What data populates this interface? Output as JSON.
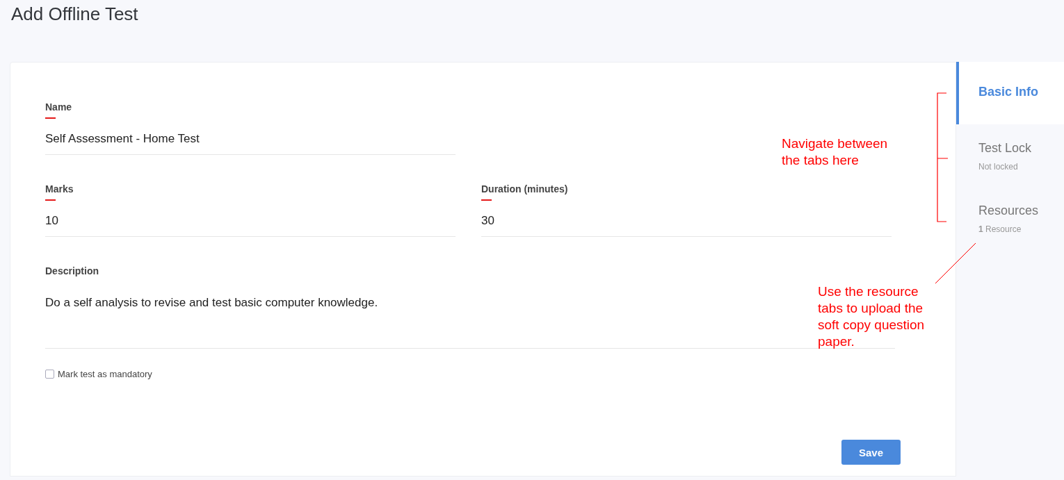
{
  "page_title": "Add Offline Test",
  "form_rows": [
    [
      {
        "label": "Name",
        "value": "Self Assessment - Home Test",
        "required": true
      }
    ],
    [
      {
        "label": "Marks",
        "value": "10",
        "required": true
      },
      {
        "label": "Duration (minutes)",
        "value": "30",
        "required": true
      }
    ],
    [
      {
        "label": "Description",
        "value": "Do a self analysis to revise and test basic computer knowledge.",
        "required": false
      }
    ]
  ],
  "checkbox": {
    "label": "Mark test as mandatory",
    "checked": false
  },
  "save_button": "Save",
  "tabs": [
    {
      "label": "Basic Info",
      "selected": true
    },
    {
      "label": "Test Lock",
      "sublabel": "Not locked",
      "selected": false
    },
    {
      "label": "Resources",
      "sublabel": "**1** Resource",
      "selected": false
    }
  ],
  "annotations": [
    {
      "kind": "bracket",
      "text": "Navigate between the tabs here"
    },
    {
      "kind": "leader",
      "text": "Use the resource tabs to upload the soft copy question paper."
    }
  ]
}
